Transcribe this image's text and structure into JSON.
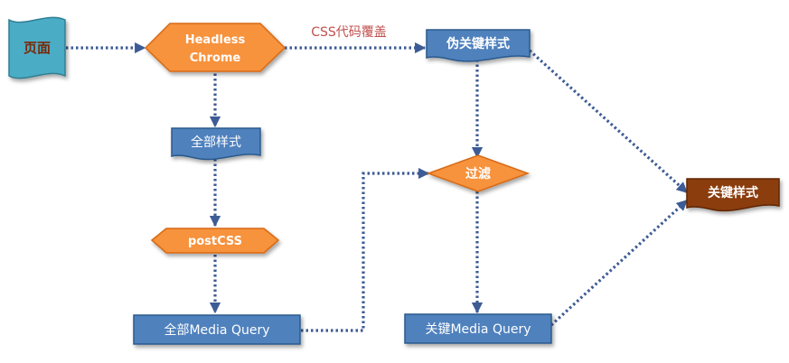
{
  "nodes": {
    "page": "页面",
    "headless_chrome_line1": "Headless",
    "headless_chrome_line2": "Chrome",
    "pseudo_critical_styles": "伪关键样式",
    "all_styles": "全部样式",
    "filter": "过滤",
    "critical_styles": "关键样式",
    "postcss": "postCSS",
    "all_media_query": "全部Media Query",
    "critical_media_query": "关键Media Query"
  },
  "edges": {
    "css_override_label": "CSS代码覆盖"
  },
  "colors": {
    "blue_fill": "#4f81bd",
    "blue_stroke": "#2c5a8c",
    "orange_fill": "#f7923c",
    "orange_stroke": "#d76a12",
    "teal_fill": "#4bacc6",
    "teal_stroke": "#2e7f93",
    "brown_fill": "#8b3c0b",
    "brown_stroke": "#5e2606",
    "arrow": "#3d5b95",
    "edge_label": "#c0504d"
  }
}
